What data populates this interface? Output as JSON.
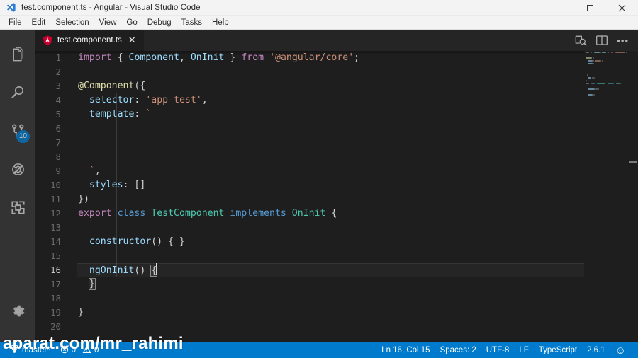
{
  "window": {
    "title": "test.component.ts - Angular - Visual Studio Code",
    "app_icon": "vscode-icon",
    "controls": {
      "minimize": "minimize-icon",
      "maximize": "maximize-icon",
      "close": "close-icon"
    }
  },
  "menubar": {
    "items": [
      {
        "label": "File"
      },
      {
        "label": "Edit"
      },
      {
        "label": "Selection"
      },
      {
        "label": "View"
      },
      {
        "label": "Go"
      },
      {
        "label": "Debug"
      },
      {
        "label": "Tasks"
      },
      {
        "label": "Help"
      }
    ]
  },
  "activitybar": {
    "items": [
      {
        "name": "explorer",
        "icon": "files-icon",
        "badge": ""
      },
      {
        "name": "search",
        "icon": "search-icon",
        "badge": ""
      },
      {
        "name": "source-control",
        "icon": "source-control-icon",
        "badge": "10"
      },
      {
        "name": "debug",
        "icon": "debug-icon",
        "badge": ""
      },
      {
        "name": "extensions",
        "icon": "extensions-icon",
        "badge": ""
      }
    ],
    "bottom": {
      "name": "manage",
      "icon": "gear-icon"
    }
  },
  "tabs": {
    "open": [
      {
        "label": "test.component.ts",
        "icon": "angular-file-icon",
        "close": "✕",
        "active": true
      }
    ],
    "actions": [
      {
        "name": "open-preview",
        "icon": "preview-icon"
      },
      {
        "name": "split-editor",
        "icon": "split-editor-icon"
      },
      {
        "name": "more-actions",
        "icon": "ellipsis-icon",
        "glyph": "•••"
      }
    ]
  },
  "editor": {
    "language": "TypeScript",
    "lines": [
      {
        "n": "1",
        "tokens": [
          {
            "t": "import",
            "c": "t-key"
          },
          {
            "t": " ",
            "c": "t-plain"
          },
          {
            "t": "{",
            "c": "t-punct"
          },
          {
            "t": " ",
            "c": "t-plain"
          },
          {
            "t": "Component",
            "c": "t-var"
          },
          {
            "t": ", ",
            "c": "t-punct"
          },
          {
            "t": "OnInit",
            "c": "t-var"
          },
          {
            "t": " ",
            "c": "t-plain"
          },
          {
            "t": "}",
            "c": "t-punct"
          },
          {
            "t": " ",
            "c": "t-plain"
          },
          {
            "t": "from",
            "c": "t-key"
          },
          {
            "t": " ",
            "c": "t-plain"
          },
          {
            "t": "'@angular/core'",
            "c": "t-str"
          },
          {
            "t": ";",
            "c": "t-punct"
          }
        ]
      },
      {
        "n": "2",
        "tokens": []
      },
      {
        "n": "3",
        "tokens": [
          {
            "t": "@Component",
            "c": "t-deco"
          },
          {
            "t": "({",
            "c": "t-punct"
          }
        ]
      },
      {
        "n": "4",
        "tokens": [
          {
            "t": "  ",
            "c": "t-plain"
          },
          {
            "t": "selector",
            "c": "t-var"
          },
          {
            "t": ": ",
            "c": "t-punct"
          },
          {
            "t": "'app-test'",
            "c": "t-str"
          },
          {
            "t": ",",
            "c": "t-punct"
          }
        ]
      },
      {
        "n": "5",
        "tokens": [
          {
            "t": "  ",
            "c": "t-plain"
          },
          {
            "t": "template",
            "c": "t-var"
          },
          {
            "t": ": ",
            "c": "t-punct"
          },
          {
            "t": "`",
            "c": "t-str"
          }
        ]
      },
      {
        "n": "6",
        "tokens": []
      },
      {
        "n": "7",
        "tokens": []
      },
      {
        "n": "8",
        "tokens": []
      },
      {
        "n": "9",
        "tokens": [
          {
            "t": "  `",
            "c": "t-str"
          },
          {
            "t": ",",
            "c": "t-punct"
          }
        ]
      },
      {
        "n": "10",
        "tokens": [
          {
            "t": "  ",
            "c": "t-plain"
          },
          {
            "t": "styles",
            "c": "t-var"
          },
          {
            "t": ": ",
            "c": "t-punct"
          },
          {
            "t": "[]",
            "c": "t-punct"
          }
        ]
      },
      {
        "n": "11",
        "tokens": [
          {
            "t": "})",
            "c": "t-punct"
          }
        ]
      },
      {
        "n": "12",
        "tokens": [
          {
            "t": "export",
            "c": "t-key"
          },
          {
            "t": " ",
            "c": "t-plain"
          },
          {
            "t": "class",
            "c": "t-kw"
          },
          {
            "t": " ",
            "c": "t-plain"
          },
          {
            "t": "TestComponent",
            "c": "t-type"
          },
          {
            "t": " ",
            "c": "t-plain"
          },
          {
            "t": "implements",
            "c": "t-kw"
          },
          {
            "t": " ",
            "c": "t-plain"
          },
          {
            "t": "OnInit",
            "c": "t-type"
          },
          {
            "t": " {",
            "c": "t-punct"
          }
        ]
      },
      {
        "n": "13",
        "tokens": []
      },
      {
        "n": "14",
        "tokens": [
          {
            "t": "  ",
            "c": "t-plain"
          },
          {
            "t": "constructor",
            "c": "t-var"
          },
          {
            "t": "() { }",
            "c": "t-punct"
          }
        ]
      },
      {
        "n": "15",
        "tokens": []
      },
      {
        "n": "16",
        "tokens": [
          {
            "t": "  ",
            "c": "t-plain"
          },
          {
            "t": "ngOnInit",
            "c": "t-var"
          },
          {
            "t": "() ",
            "c": "t-punct"
          }
        ],
        "match_open": "{",
        "cursor": true,
        "current": true
      },
      {
        "n": "17",
        "tokens": [
          {
            "t": "  ",
            "c": "t-plain"
          }
        ],
        "match_close": "}"
      },
      {
        "n": "18",
        "tokens": []
      },
      {
        "n": "19",
        "tokens": [
          {
            "t": "}",
            "c": "t-punct"
          }
        ]
      },
      {
        "n": "20",
        "tokens": []
      }
    ]
  },
  "statusbar": {
    "left": [
      {
        "name": "branch",
        "icon": "source-control-icon",
        "label": "master*"
      },
      {
        "name": "errors-warnings",
        "icon": "error-warning-icon",
        "label": "0",
        "label2": "0"
      }
    ],
    "right": [
      {
        "name": "cursor-position",
        "label": "Ln 16, Col 15"
      },
      {
        "name": "indentation",
        "label": "Spaces: 2"
      },
      {
        "name": "encoding",
        "label": "UTF-8"
      },
      {
        "name": "eol",
        "label": "LF"
      },
      {
        "name": "language-mode",
        "label": "TypeScript"
      },
      {
        "name": "ts-version",
        "label": "2.6.1"
      },
      {
        "name": "feedback",
        "label": "☺"
      }
    ]
  },
  "watermark": {
    "text": "aparat.com/mr_rahimi"
  },
  "colors": {
    "accent": "#007acc",
    "titlebar_bg": "#f3f3f3",
    "activitybar_bg": "#333333",
    "editor_bg": "#1e1e1e",
    "tabs_bg": "#252526"
  }
}
